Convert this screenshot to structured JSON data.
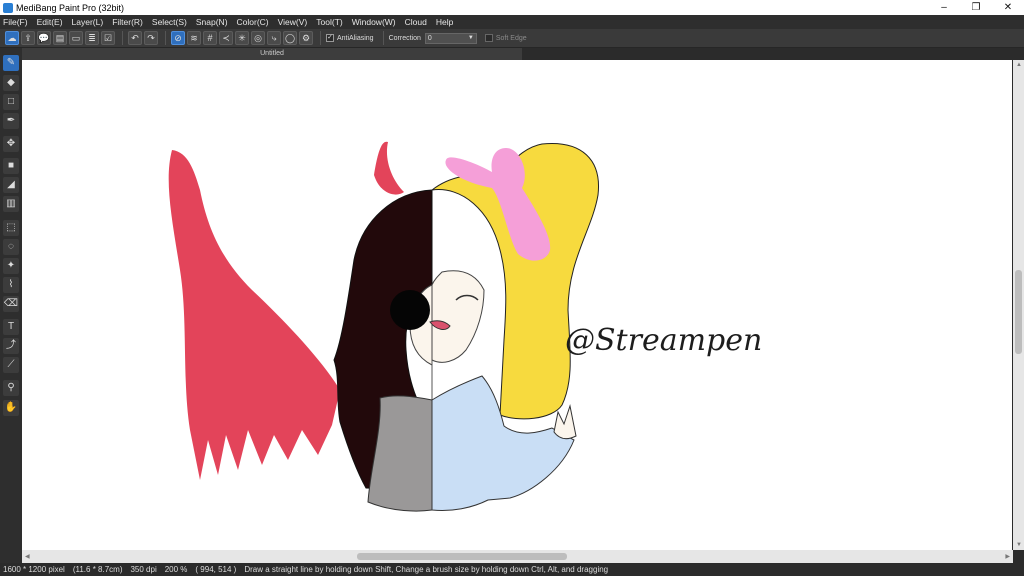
{
  "window": {
    "title": "MediBang Paint Pro (32bit)",
    "minimize": "–",
    "maximize": "❐",
    "close": "✕"
  },
  "menu": [
    "File(F)",
    "Edit(E)",
    "Layer(L)",
    "Filter(R)",
    "Select(S)",
    "Snap(N)",
    "Color(C)",
    "View(V)",
    "Tool(T)",
    "Window(W)",
    "Cloud",
    "Help"
  ],
  "toolbar": {
    "antialiasing_label": "AntiAliasing",
    "correction_label": "Correction",
    "correction_value": "0",
    "soft_edge_label": "Soft Edge"
  },
  "document": {
    "tab_title": "Untitled"
  },
  "artwork": {
    "signature": "@Streampen"
  },
  "status": {
    "size": "1600 * 1200 pixel",
    "cm": "(11.6 * 8.7cm)",
    "dpi": "350 dpi",
    "zoom": "200 %",
    "coords": "( 994, 514 )",
    "hint": "Draw a straight line by holding down Shift, Change a brush size by holding down Ctrl, Alt, and dragging"
  },
  "colors": {
    "accent": "#2f6fbd",
    "red": "#e3445a",
    "yellow": "#f7da3e",
    "pink": "#f59fd8",
    "black_hair": "#22090b",
    "blue_shirt": "#c9def5",
    "gray_shirt": "#9a9898"
  }
}
